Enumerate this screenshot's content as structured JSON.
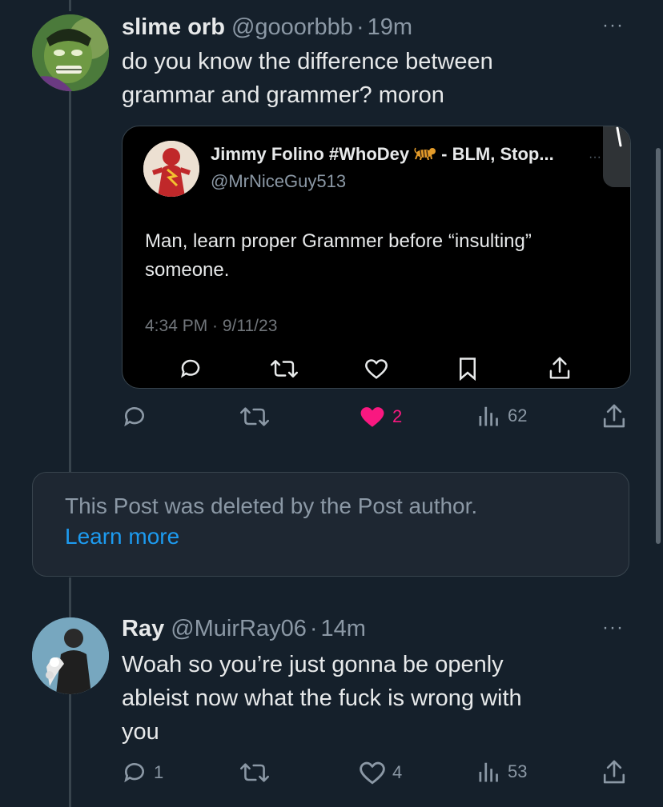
{
  "tweet1": {
    "display_name": "slime orb",
    "handle": "@gooorbbb",
    "dot": "·",
    "time": "19m",
    "text_line1": "do you know the difference between",
    "text_line2": "grammar and grammer? moron",
    "more": "···",
    "actions": {
      "likes": "2",
      "views": "62"
    },
    "colors": {
      "liked": "#f91880"
    }
  },
  "quote": {
    "display_name": "Jimmy Folino #WhoDey",
    "emoji_icon": "tiger-emoji",
    "display_name_rest": "- BLM, Stop...",
    "handle": "@MrNiceGuy513",
    "more": "···",
    "text_line1": "Man, learn proper Grammer before “insulting”",
    "text_line2": "someone.",
    "timestamp": "4:34 PM · 9/11/23"
  },
  "deleted": {
    "text": "This Post was deleted by the Post author.",
    "link": "Learn more"
  },
  "tweet2": {
    "display_name": "Ray",
    "handle": "@MuirRay06",
    "dot": "·",
    "time": "14m",
    "text_line1": "Woah so you’re just gonna be openly",
    "text_line2": "ableist now what the fuck is wrong with",
    "text_line3": "you",
    "more": "···",
    "actions": {
      "replies": "1",
      "likes": "4",
      "views": "53"
    }
  },
  "theme": {
    "background": "#15202b",
    "link": "#1d9bf0",
    "muted": "#8b98a5"
  }
}
